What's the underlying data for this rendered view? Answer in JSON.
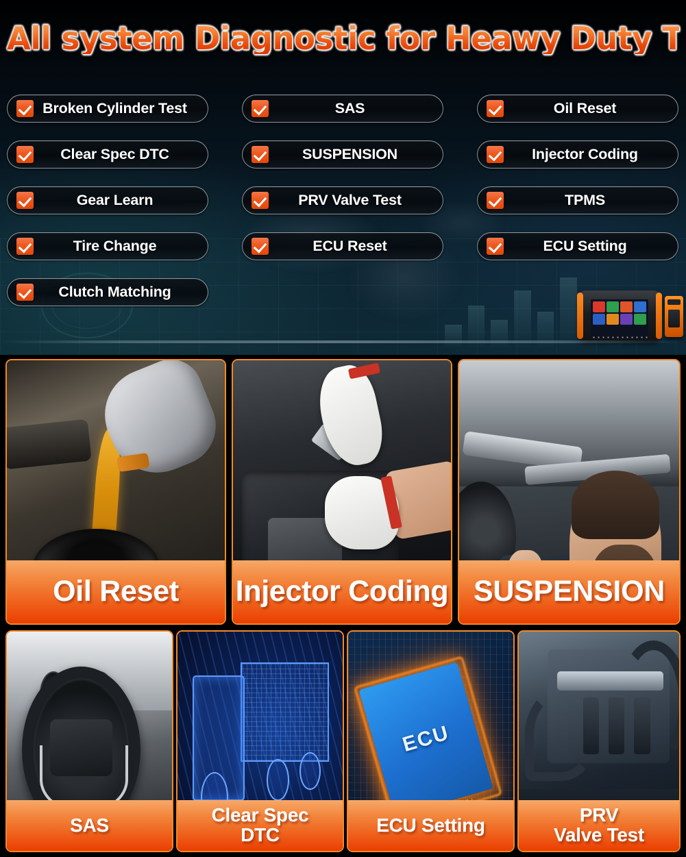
{
  "hero": {
    "title": "All system Diagnostic for Heawy Duty Trueks",
    "features": [
      {
        "label": "Broken Cylinder Test",
        "checked": true
      },
      {
        "label": "SAS",
        "checked": true
      },
      {
        "label": "Oil Reset",
        "checked": true
      },
      {
        "label": "Clear Spec DTC",
        "checked": true
      },
      {
        "label": "SUSPENSION",
        "checked": true
      },
      {
        "label": "Injector Coding",
        "checked": true
      },
      {
        "label": "Gear Learn",
        "checked": true
      },
      {
        "label": "PRV Valve Test",
        "checked": true
      },
      {
        "label": "TPMS",
        "checked": true
      },
      {
        "label": "Tire Change",
        "checked": true
      },
      {
        "label": "ECU Reset",
        "checked": true
      },
      {
        "label": "ECU Setting",
        "checked": true
      },
      {
        "label": "Clutch Matching",
        "checked": true
      }
    ],
    "device": {
      "name": "diagnostic-tablet",
      "screen_app_colors": [
        "#d9382c",
        "#2f9e4f",
        "#e0552a",
        "#2f6fd0",
        "#2b5fc4",
        "#e08a1e",
        "#6a40b8",
        "#2f9e4f"
      ],
      "dongle_name": "obd-connector"
    }
  },
  "tiles": {
    "row1": [
      {
        "caption": "Oil Reset",
        "scene": "oil-pouring-into-engine"
      },
      {
        "caption": "Injector Coding",
        "scene": "gloved-hands-engine-wrench"
      },
      {
        "caption": "SUSPENSION",
        "scene": "mechanic-under-lifted-car"
      }
    ],
    "row2": [
      {
        "caption": "SAS",
        "scene": "steering-wheel-dashboard"
      },
      {
        "caption": "Clear Spec\nDTC",
        "scene": "blue-wireframe-truck"
      },
      {
        "caption": "ECU Setting",
        "scene": "glowing-ecu-chip-pcb",
        "chip_label": "ECU"
      },
      {
        "caption": "PRV\nValve Test",
        "scene": "dark-engine-bay"
      }
    ]
  },
  "colors": {
    "accent_orange": "#F08A28",
    "caption_top": "#F7A868",
    "caption_bottom": "#EA3E02",
    "checkbox_orange": "#EE5A22",
    "background_dark": "#000000",
    "hero_teal": "#0B2733"
  }
}
